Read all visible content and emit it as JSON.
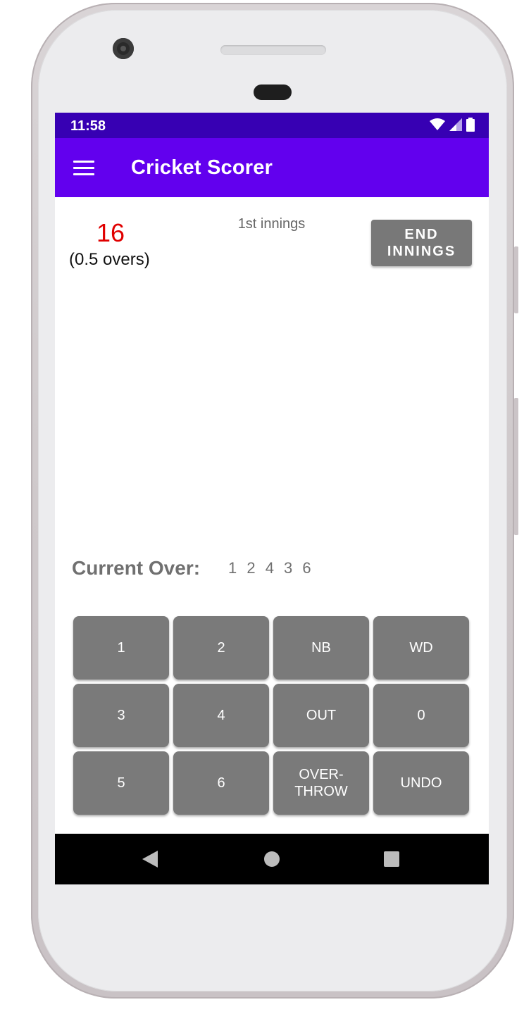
{
  "status_bar": {
    "time": "11:58",
    "icons": [
      "wifi-icon",
      "signal-icon",
      "battery-icon"
    ]
  },
  "app_bar": {
    "title": "Cricket Scorer",
    "menu_icon": "hamburger-menu-icon"
  },
  "score": {
    "runs": "16",
    "overs": "(0.5 overs)",
    "innings": "1st innings",
    "end_innings_label": "END\nINNINGS"
  },
  "current_over": {
    "label": "Current Over:",
    "balls": "1 2 4 3 6"
  },
  "keypad": [
    {
      "label": "1"
    },
    {
      "label": "2"
    },
    {
      "label": "NB"
    },
    {
      "label": "WD"
    },
    {
      "label": "3"
    },
    {
      "label": "4"
    },
    {
      "label": "OUT"
    },
    {
      "label": "0"
    },
    {
      "label": "5"
    },
    {
      "label": "6"
    },
    {
      "label": "OVER-\nTHROW"
    },
    {
      "label": "UNDO"
    }
  ],
  "nav_bar": {
    "icons": [
      "back-icon",
      "home-icon",
      "recents-icon"
    ]
  },
  "colors": {
    "status_bar": "#3700b3",
    "app_bar": "#6200ee",
    "score": "#e00000",
    "button": "#7a7a7a"
  }
}
